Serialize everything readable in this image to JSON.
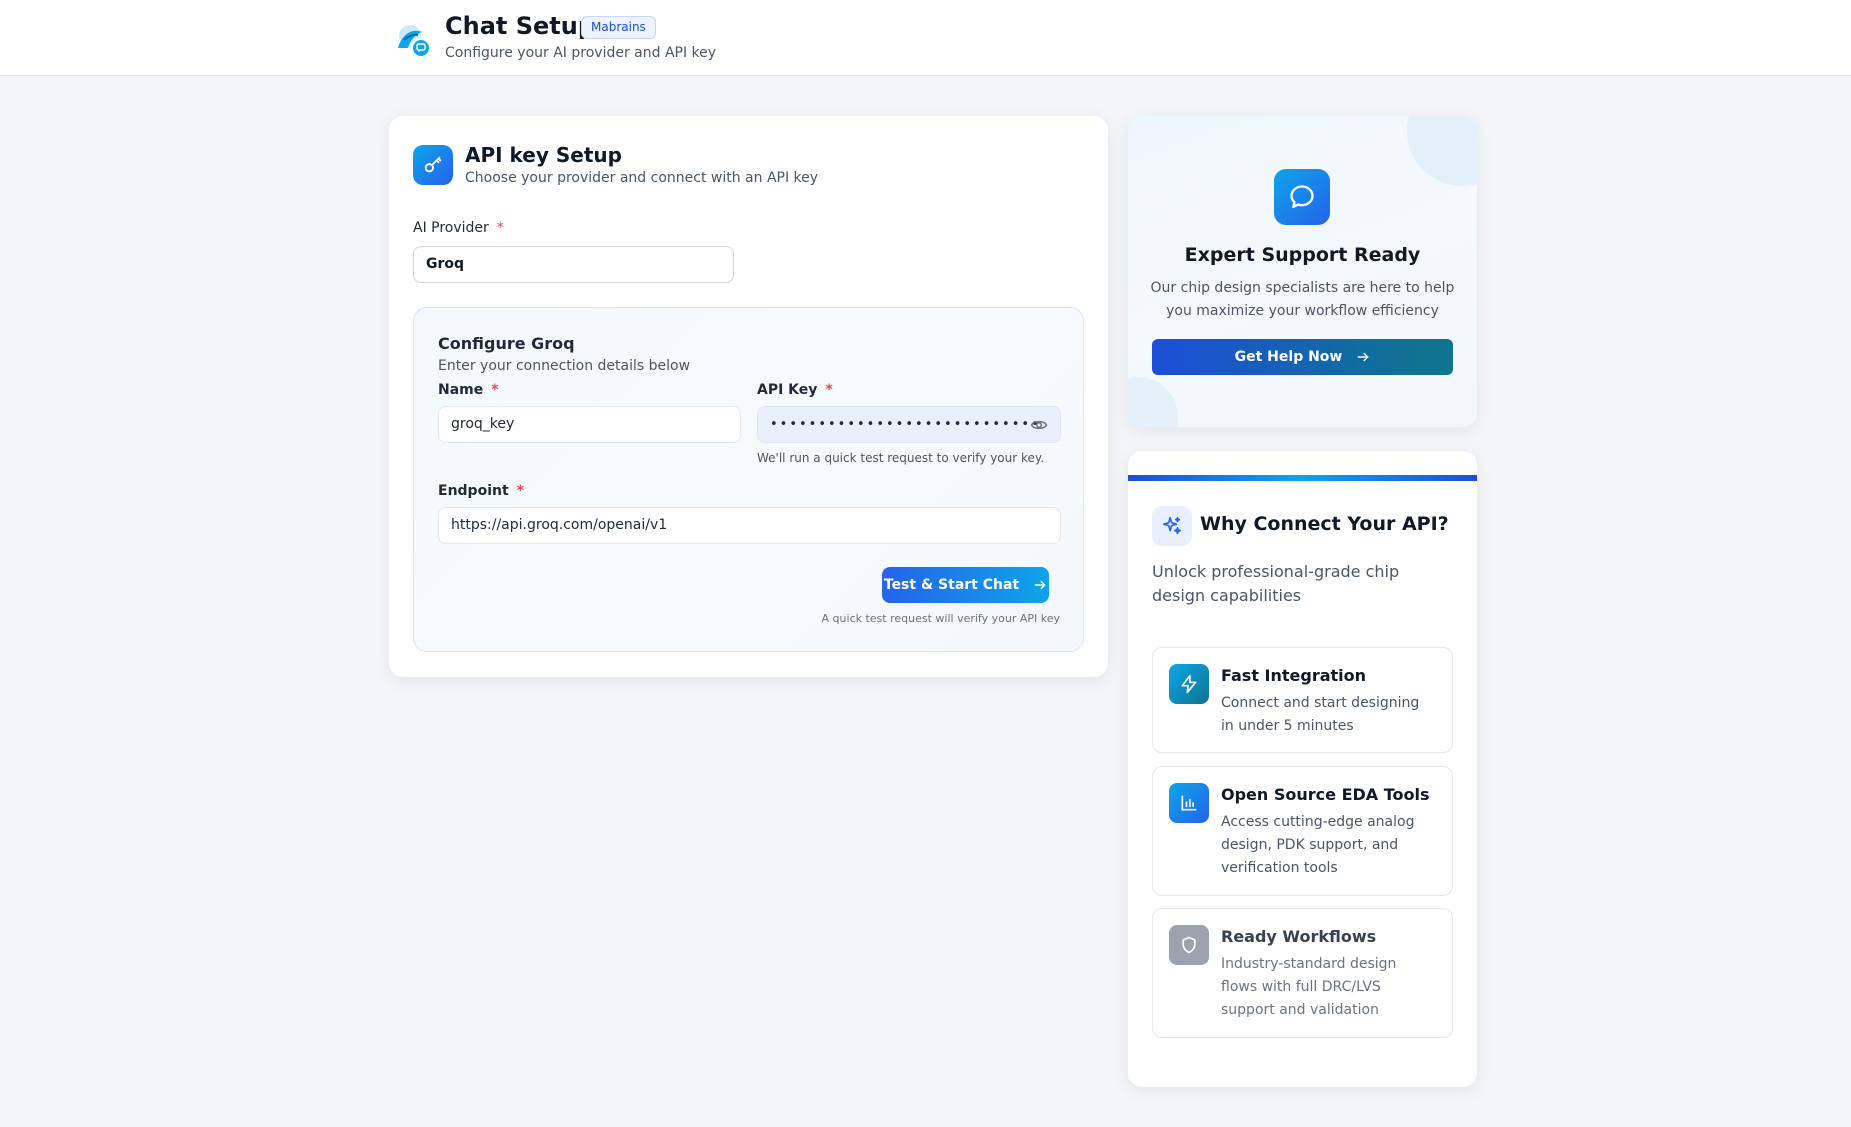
{
  "header": {
    "title": "Chat Setup",
    "badge": "Mabrains",
    "subtitle": "Configure your AI provider and API key"
  },
  "setup_card": {
    "title": "API key Setup",
    "subtitle": "Choose your provider and connect with an API key",
    "provider_label": "AI Provider",
    "required_mark": "*",
    "provider_value": "Groq",
    "config": {
      "title": "Configure Groq",
      "subtitle": "Enter your connection details below",
      "name_label": "Name",
      "name_value": "groq_key",
      "api_key_label": "API Key",
      "api_key_value": "••••••••••••••••••••••••••••",
      "api_key_hint": "We'll run a quick test request to verify your key.",
      "endpoint_label": "Endpoint",
      "endpoint_value": "https://api.groq.com/openai/v1",
      "submit_label": "Test & Start Chat",
      "submit_hint": "A quick test request will verify your API key"
    }
  },
  "support": {
    "title": "Expert Support Ready",
    "description": "Our chip design specialists are here to help you maximize your workflow efficiency",
    "button_label": "Get Help Now"
  },
  "why": {
    "title": "Why Connect Your API?",
    "subtitle": "Unlock professional-grade chip design capabilities",
    "features": [
      {
        "title": "Fast Integration",
        "description": "Connect and start designing in under 5 minutes",
        "icon": "lightning-icon",
        "color": "#0ea5e9"
      },
      {
        "title": "Open Source EDA Tools",
        "description": "Access cutting-edge analog design, PDK support, and verification tools",
        "icon": "bar-chart-icon",
        "color": "#2563eb"
      },
      {
        "title": "Ready Workflows",
        "description": "Industry-standard design flows with full DRC/LVS support and validation",
        "icon": "shield-icon",
        "color": "#9ca3af"
      }
    ]
  },
  "colors": {
    "accent": "#2563eb",
    "accent_teal": "#0ea5e9",
    "required": "#ef4444"
  }
}
